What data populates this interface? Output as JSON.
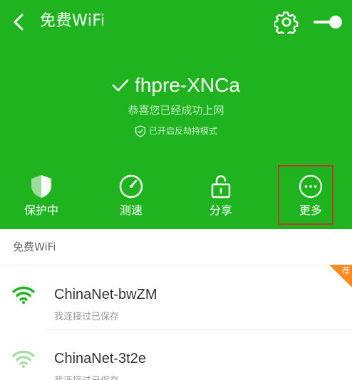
{
  "topbar": {
    "title": "免费WiFi",
    "back_icon": "chevron-left-icon",
    "settings_icon": "gear-icon",
    "toggle_on": true
  },
  "connection": {
    "ssid": "fhpre-XNCa",
    "status": "恭喜您已经成功上网",
    "guard": "已开启反劫持模式"
  },
  "actions": [
    {
      "label": "保护中",
      "icon": "shield-icon"
    },
    {
      "label": "测速",
      "icon": "speedometer-icon"
    },
    {
      "label": "分享",
      "icon": "lock-share-icon"
    },
    {
      "label": "更多",
      "icon": "more-icon"
    }
  ],
  "list": {
    "section_title": "免费WiFi",
    "networks": [
      {
        "name": "ChinaNet-bwZM",
        "sub": "我连接过已保存",
        "signal": "strong",
        "badge": "荐"
      },
      {
        "name": "ChinaNet-3t2e",
        "sub": "我连接过已保存",
        "signal": "weak"
      }
    ]
  },
  "colors": {
    "header_green": "#1fb41f",
    "wifi_strong": "#1fb41f",
    "wifi_weak": "#a8dca8",
    "badge_orange": "#ff8a1f",
    "highlight_red": "#c0392b"
  }
}
